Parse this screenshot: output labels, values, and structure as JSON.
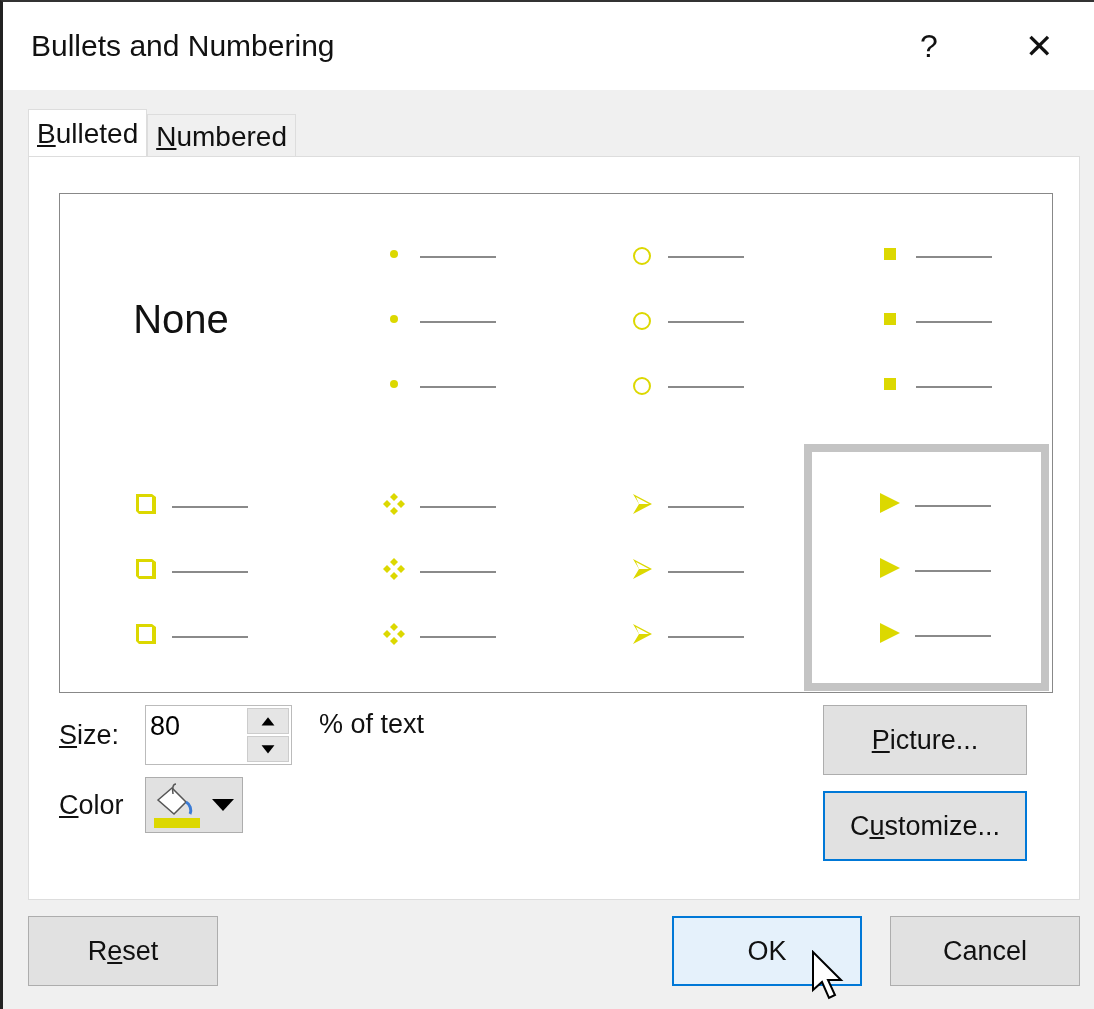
{
  "window": {
    "title": "Bullets and Numbering",
    "help": "?",
    "close": "✕"
  },
  "tabs": [
    {
      "key": "B",
      "after": "ulleted",
      "selected": true
    },
    {
      "key": "N",
      "after": "umbered",
      "selected": false
    }
  ],
  "bullets": [
    {
      "kind": "none",
      "label": "None",
      "selected": false
    },
    {
      "kind": "dot",
      "selected": false
    },
    {
      "kind": "circle",
      "selected": false
    },
    {
      "kind": "square",
      "selected": false
    },
    {
      "kind": "box",
      "selected": false
    },
    {
      "kind": "diamonds",
      "selected": false
    },
    {
      "kind": "arrowhead",
      "selected": false
    },
    {
      "kind": "triangle",
      "selected": true
    }
  ],
  "size": {
    "label": {
      "key": "S",
      "after": "ize:"
    },
    "value": "80",
    "unit": "% of text"
  },
  "color": {
    "label": {
      "key": "C",
      "after": "olor"
    }
  },
  "side_buttons": [
    {
      "key": "P",
      "after": "icture...",
      "kind": "plain"
    },
    {
      "before": "C",
      "key": "u",
      "after": "stomize...",
      "kind": "focused"
    }
  ],
  "footer_buttons": [
    {
      "before": "R",
      "key": "e",
      "after": "set",
      "kind": "plain"
    },
    {
      "after": "OK",
      "kind": "hovered"
    },
    {
      "after": "Cancel",
      "kind": "plain"
    }
  ]
}
